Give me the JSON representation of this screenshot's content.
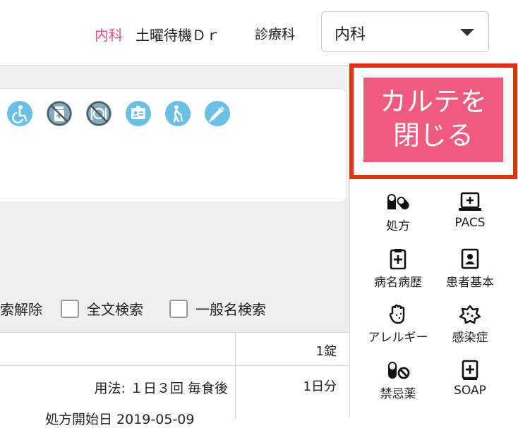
{
  "header": {
    "department_highlight": "内科",
    "doctor": "土曜待機Ｄｒ",
    "department_label": "診療科",
    "department_select_value": "内科"
  },
  "status_icons": [
    "wheelchair-icon",
    "medicine-bottle-prohibited-icon",
    "meal-prohibited-icon",
    "id-card-icon",
    "elderly-walking-icon",
    "syringe-icon"
  ],
  "search": {
    "clear_label": "索解除",
    "fulltext_label": "全文検索",
    "generic_label": "一般名検索"
  },
  "table": {
    "row1_qty": "1錠",
    "row2_usage": "用法: １日３回 毎食後",
    "row2_qty": "1日分",
    "row3_partial": "処方開始日 2019-05-09"
  },
  "close_button": {
    "line1": "カルテを",
    "line2": "閉じる"
  },
  "tools": [
    {
      "label": "処方",
      "icon": "pills-icon"
    },
    {
      "label": "PACS",
      "icon": "monitor-plus-icon"
    },
    {
      "label": "病名病歴",
      "icon": "clipboard-plus-icon"
    },
    {
      "label": "患者基本",
      "icon": "patient-card-icon"
    },
    {
      "label": "アレルギー",
      "icon": "hand-allergy-icon"
    },
    {
      "label": "感染症",
      "icon": "virus-icon"
    },
    {
      "label": "禁忌薬",
      "icon": "pill-prohibited-icon"
    },
    {
      "label": "SOAP",
      "icon": "book-plus-icon"
    }
  ],
  "colors": {
    "accent_pink": "#ef5a7e",
    "highlight_border": "#e0320f",
    "status_icon_blue": "#69c0e6"
  }
}
